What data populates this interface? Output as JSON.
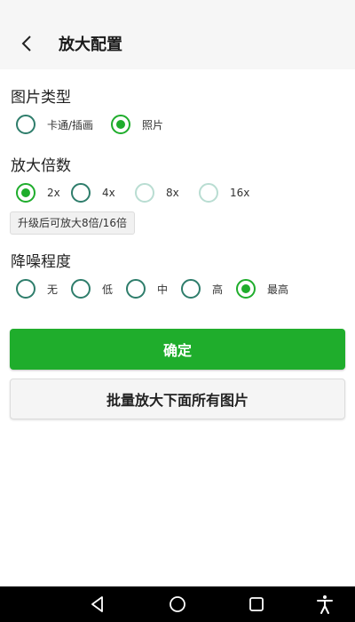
{
  "header": {
    "title": "放大配置",
    "back_icon": "chevron-left-icon"
  },
  "image_type": {
    "title": "图片类型",
    "options": [
      {
        "label": "卡通/插画",
        "checked": false
      },
      {
        "label": "照片",
        "checked": true
      }
    ]
  },
  "scale": {
    "title": "放大倍数",
    "options": [
      {
        "label": "2x",
        "checked": true,
        "enabled": true
      },
      {
        "label": "4x",
        "checked": false,
        "enabled": true
      },
      {
        "label": "8x",
        "checked": false,
        "enabled": false
      },
      {
        "label": "16x",
        "checked": false,
        "enabled": false
      }
    ],
    "upgrade_label": "升级后可放大8倍/16倍"
  },
  "denoise": {
    "title": "降噪程度",
    "options": [
      {
        "label": "无",
        "checked": false
      },
      {
        "label": "低",
        "checked": false
      },
      {
        "label": "中",
        "checked": false
      },
      {
        "label": "高",
        "checked": false
      },
      {
        "label": "最高",
        "checked": true
      }
    ]
  },
  "actions": {
    "confirm_label": "确定",
    "batch_label": "批量放大下面所有图片"
  },
  "navbar": {
    "icons": [
      "back-triangle-icon",
      "home-circle-icon",
      "recents-square-icon",
      "accessibility-icon"
    ]
  },
  "colors": {
    "accent": "#1fad2c",
    "radio_border": "#2e7d6b",
    "radio_disabled": "#b9ddd2",
    "header_bg": "#f6f6f6"
  }
}
